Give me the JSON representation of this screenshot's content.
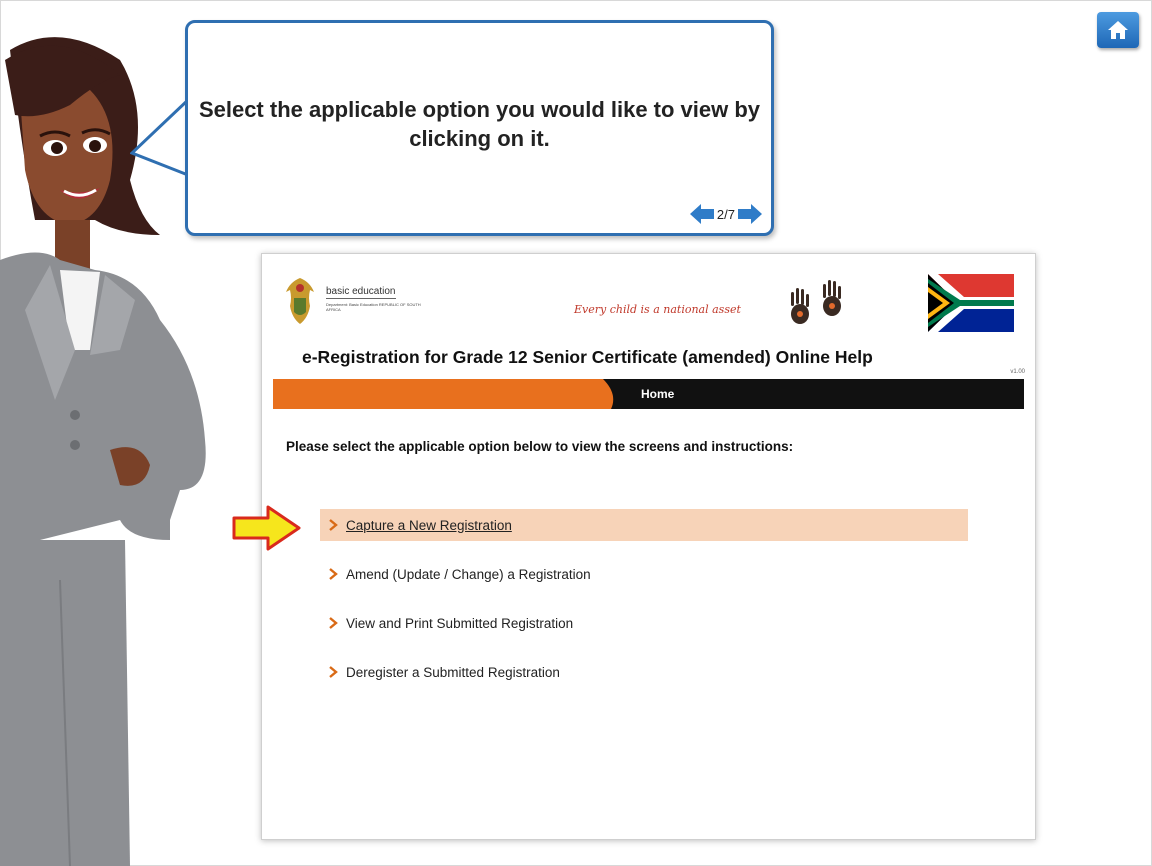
{
  "bubble": {
    "text": "Select the applicable option you would like to view by clicking on it.",
    "page": "2/7"
  },
  "header": {
    "logo_title": "basic education",
    "logo_subtitle": "Department: Basic Education REPUBLIC OF SOUTH AFRICA",
    "tagline": "Every child is a national asset",
    "title": "e-Registration for Grade 12 Senior Certificate (amended) Online Help",
    "version": "v1.00"
  },
  "nav": {
    "home_label": "Home"
  },
  "instruction": "Please select the applicable option below to view the screens and instructions:",
  "options": [
    {
      "label": "Capture a New Registration",
      "highlighted": true
    },
    {
      "label": "Amend (Update / Change) a Registration",
      "highlighted": false
    },
    {
      "label": "View and Print Submitted Registration",
      "highlighted": false
    },
    {
      "label": "Deregister a Submitted Registration",
      "highlighted": false
    }
  ],
  "icons": {
    "home": "home-icon",
    "prev": "arrow-left-icon",
    "next": "arrow-right-icon",
    "chevron": "chevron-right-icon",
    "pointer": "pointer-arrow-icon"
  },
  "colors": {
    "accent_blue": "#2f6fb1",
    "nav_orange": "#e8701e",
    "nav_black": "#111111",
    "highlight": "#f7d3b8",
    "pointer_yellow": "#f6e61c",
    "pointer_red": "#d92a1c"
  }
}
